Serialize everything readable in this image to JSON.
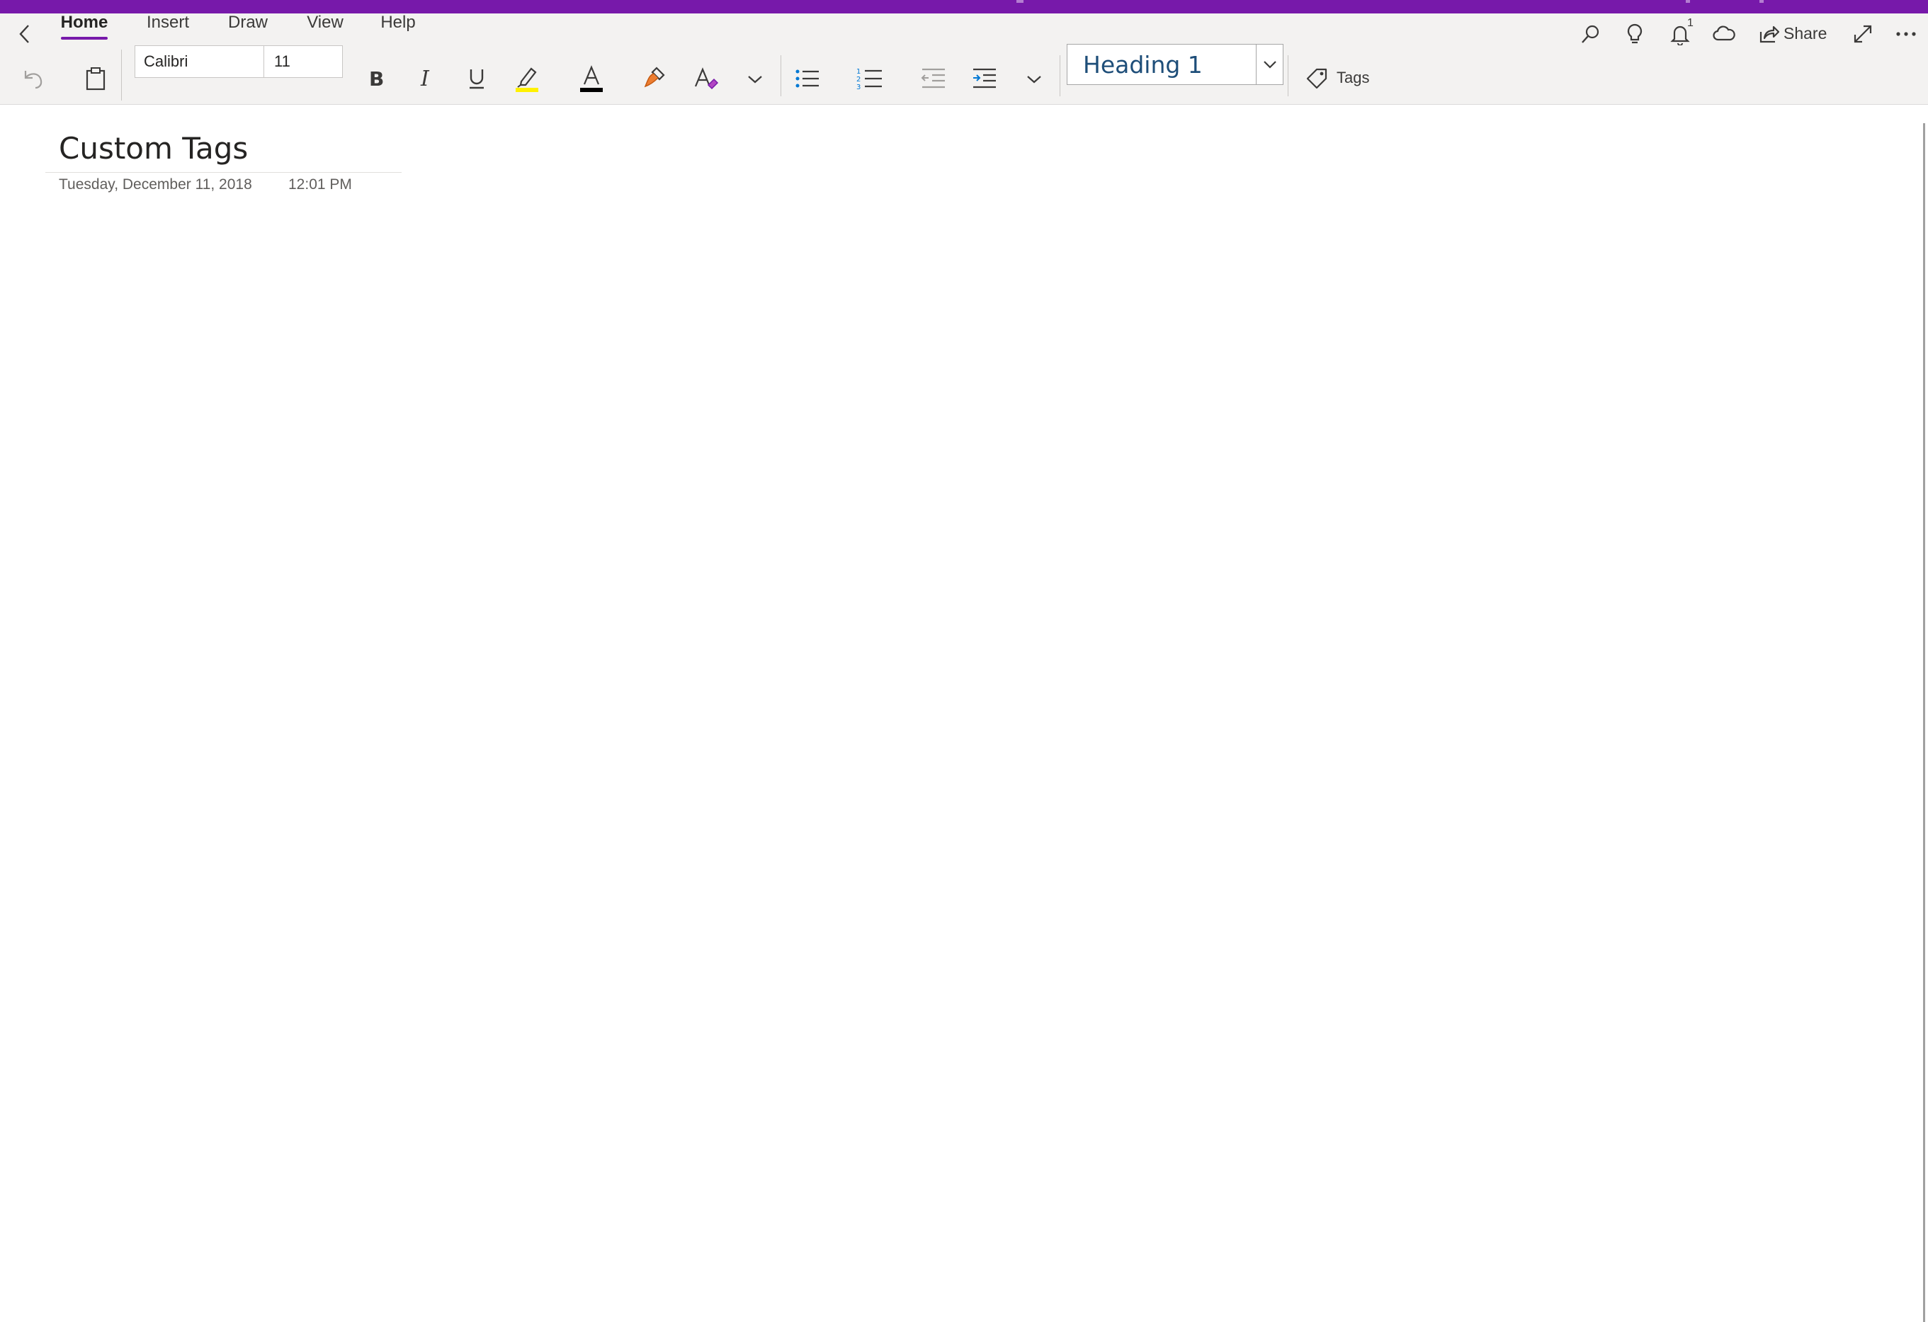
{
  "app": {
    "accent_color": "#7719aa",
    "heading_color": "#1e4e79"
  },
  "tabs": [
    {
      "label": "Home",
      "active": true
    },
    {
      "label": "Insert",
      "active": false
    },
    {
      "label": "Draw",
      "active": false
    },
    {
      "label": "View",
      "active": false
    },
    {
      "label": "Help",
      "active": false
    }
  ],
  "ribbon": {
    "font_name": "Calibri",
    "font_size": "11",
    "style": "Heading 1",
    "tags_label": "Tags",
    "highlight_color": "#fff100",
    "font_color": "#000000"
  },
  "top_actions": {
    "share_label": "Share",
    "notification_count": "1"
  },
  "page": {
    "title": "Custom Tags",
    "date": "Tuesday, December 11, 2018",
    "time": "12:01 PM"
  },
  "icons": [
    "back-icon",
    "undo-icon",
    "clipboard-icon",
    "bold-icon",
    "italic-icon",
    "underline-icon",
    "highlighter-icon",
    "font-color-icon",
    "format-painter-icon",
    "clear-formatting-icon",
    "chevron-down-icon",
    "bullet-list-icon",
    "numbered-list-icon",
    "decrease-indent-icon",
    "increase-indent-icon",
    "tag-icon",
    "search-icon",
    "lightbulb-icon",
    "bell-icon",
    "cloud-sync-icon",
    "share-icon",
    "expand-icon",
    "more-icon"
  ]
}
